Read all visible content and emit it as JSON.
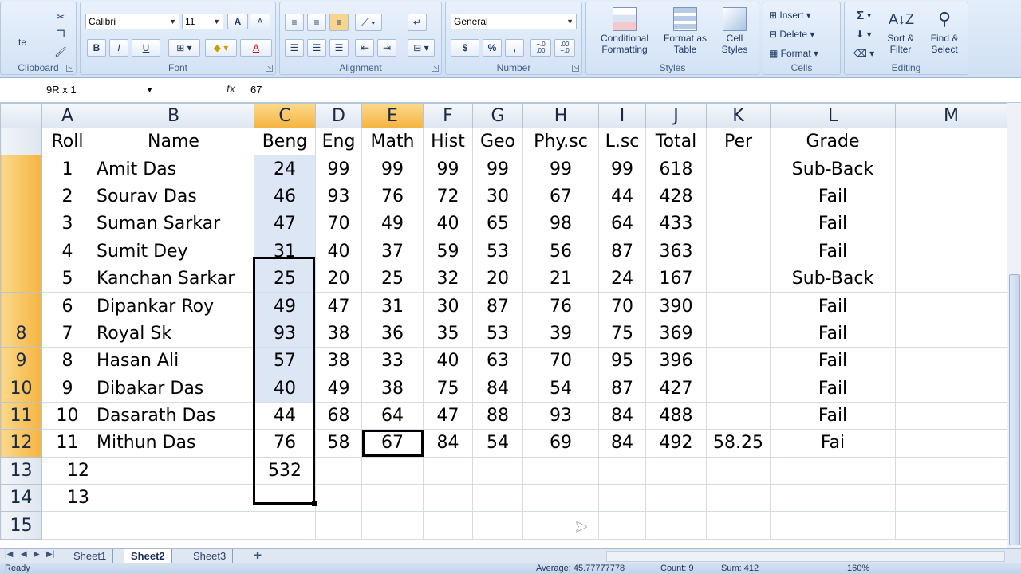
{
  "ribbon": {
    "clipboard": {
      "paste_label": "te",
      "group_label": "Clipboard"
    },
    "font": {
      "name": "Calibri",
      "size": "11",
      "grow": "A",
      "shrink": "A",
      "bold": "B",
      "italic": "I",
      "underline": "U",
      "font_color": "A",
      "group_label": "Font"
    },
    "alignment": {
      "group_label": "Alignment"
    },
    "number": {
      "format": "General",
      "currency": "$",
      "percent": "%",
      "comma": ",",
      "inc_dec": "+.0\n.00",
      "dec_dec": ".00\n+.0",
      "group_label": "Number"
    },
    "styles": {
      "conditional": "Conditional Formatting",
      "format_table": "Format as Table",
      "cell_styles": "Cell Styles",
      "group_label": "Styles"
    },
    "cells": {
      "insert": "Insert",
      "delete": "Delete",
      "format": "Format",
      "group_label": "Cells"
    },
    "editing": {
      "sum": "Σ",
      "sort": "Sort & Filter",
      "find": "Find & Select",
      "group_label": "Editing"
    }
  },
  "formula_bar": {
    "name_box": "9R x 1",
    "fx": "fx",
    "value": "67"
  },
  "columns": [
    "A",
    "B",
    "C",
    "D",
    "E",
    "F",
    "G",
    "H",
    "I",
    "J",
    "K",
    "L",
    "M"
  ],
  "headers": {
    "row_label": "",
    "values": [
      "Roll",
      "Name",
      "Beng",
      "Eng",
      "Math",
      "Hist",
      "Geo",
      "Phy.sc",
      "L.sc",
      "Total",
      "Per",
      "Grade",
      ""
    ]
  },
  "rows": [
    {
      "num": "",
      "cells": [
        "1",
        "Amit Das",
        "24",
        "99",
        "99",
        "99",
        "99",
        "99",
        "99",
        "618",
        "",
        "Sub-Back",
        ""
      ]
    },
    {
      "num": "",
      "cells": [
        "2",
        "Sourav Das",
        "46",
        "93",
        "76",
        "72",
        "30",
        "67",
        "44",
        "428",
        "",
        "Fail",
        ""
      ]
    },
    {
      "num": "",
      "cells": [
        "3",
        "Suman Sarkar",
        "47",
        "70",
        "49",
        "40",
        "65",
        "98",
        "64",
        "433",
        "",
        "Fail",
        ""
      ]
    },
    {
      "num": "",
      "cells": [
        "4",
        "Sumit Dey",
        "31",
        "40",
        "37",
        "59",
        "53",
        "56",
        "87",
        "363",
        "",
        "Fail",
        ""
      ]
    },
    {
      "num": "",
      "cells": [
        "5",
        "Kanchan Sarkar",
        "25",
        "20",
        "25",
        "32",
        "20",
        "21",
        "24",
        "167",
        "",
        "Sub-Back",
        ""
      ]
    },
    {
      "num": "",
      "cells": [
        "6",
        "Dipankar Roy",
        "49",
        "47",
        "31",
        "30",
        "87",
        "76",
        "70",
        "390",
        "",
        "Fail",
        ""
      ]
    },
    {
      "num": "8",
      "cells": [
        "7",
        "Royal Sk",
        "93",
        "38",
        "36",
        "35",
        "53",
        "39",
        "75",
        "369",
        "",
        "Fail",
        ""
      ]
    },
    {
      "num": "9",
      "cells": [
        "8",
        "Hasan Ali",
        "57",
        "38",
        "33",
        "40",
        "63",
        "70",
        "95",
        "396",
        "",
        "Fail",
        ""
      ]
    },
    {
      "num": "10",
      "cells": [
        "9",
        "Dibakar Das",
        "40",
        "49",
        "38",
        "75",
        "84",
        "54",
        "87",
        "427",
        "",
        "Fail",
        ""
      ]
    },
    {
      "num": "11",
      "cells": [
        "10",
        "Dasarath Das",
        "44",
        "68",
        "64",
        "47",
        "88",
        "93",
        "84",
        "488",
        "",
        "Fail",
        ""
      ]
    },
    {
      "num": "12",
      "cells": [
        "11",
        "Mithun Das",
        "76",
        "58",
        "67",
        "84",
        "54",
        "69",
        "84",
        "492",
        "58.25",
        "Fai",
        ""
      ]
    },
    {
      "num": "13",
      "cells": [
        "12",
        "",
        "532",
        "",
        "",
        "",
        "",
        "",
        "",
        "",
        "",
        "",
        ""
      ]
    },
    {
      "num": "14",
      "cells": [
        "13",
        "",
        "",
        "",
        "",
        "",
        "",
        "",
        "",
        "",
        "",
        "",
        ""
      ]
    },
    {
      "num": "15",
      "cells": [
        "",
        "",
        "",
        "",
        "",
        "",
        "",
        "",
        "",
        "",
        "",
        "",
        ""
      ]
    }
  ],
  "sheets": [
    "Sheet1",
    "Sheet2",
    "Sheet3"
  ],
  "status": {
    "ready": "Ready",
    "average": "Average: 45.77777778",
    "count": "Count: 9",
    "sum": "Sum: 412",
    "zoom": "160%"
  },
  "colors": {
    "accent": "#f6b33f",
    "ribbon": "#d3e2f5",
    "selection": "#dde6f4"
  }
}
